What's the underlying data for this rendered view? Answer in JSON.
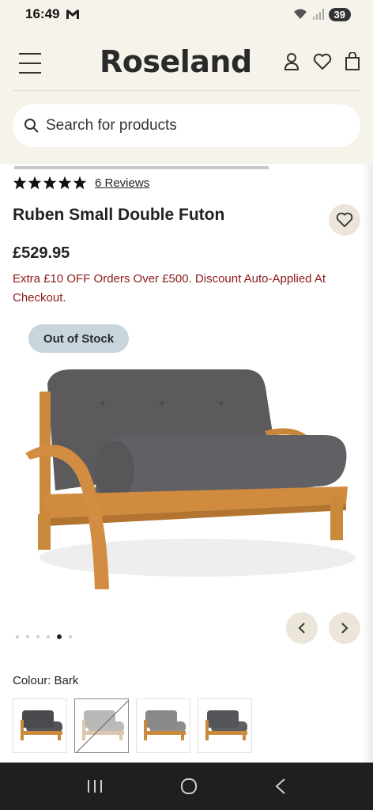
{
  "status_bar": {
    "time": "16:49",
    "battery": "39"
  },
  "header": {
    "logo": "Roseland",
    "search_placeholder": "Search for products"
  },
  "product": {
    "rating_stars": 5,
    "reviews_label": "6 Reviews",
    "title": "Ruben Small Double Futon",
    "price": "£529.95",
    "promo": "Extra £10 OFF Orders Over £500. Discount Auto-Applied At Checkout.",
    "stock_badge": "Out of Stock",
    "colour_label": "Colour: Bark"
  },
  "carousel": {
    "dot_count": 6,
    "active_index": 4
  },
  "swatches": [
    {
      "name": "swatch-1",
      "cushion": "#4b4b4f",
      "wood": "#c98a3c",
      "crossed": false
    },
    {
      "name": "swatch-2",
      "cushion": "#b9b8b7",
      "wood": "#dbc7ad",
      "crossed": true
    },
    {
      "name": "swatch-3",
      "cushion": "#8a8886",
      "wood": "#c98a3c",
      "crossed": false
    },
    {
      "name": "swatch-4",
      "cushion": "#55565a",
      "wood": "#c98a3c",
      "crossed": false
    }
  ],
  "colors": {
    "header_bg": "#f6f3ea",
    "promo_text": "#8b1a1a",
    "badge_bg": "#c9d5dd",
    "button_bg": "#ebe6d9",
    "futon_cushion": "#5b5a5d",
    "futon_wood": "#d08b3f"
  },
  "icons": [
    "gmail-icon",
    "wifi-icon",
    "signal-icon",
    "hamburger-icon",
    "account-icon",
    "heart-icon",
    "bag-icon",
    "search-icon",
    "star-icon",
    "chevron-left-icon",
    "chevron-right-icon",
    "recents-icon",
    "home-icon",
    "back-icon"
  ]
}
